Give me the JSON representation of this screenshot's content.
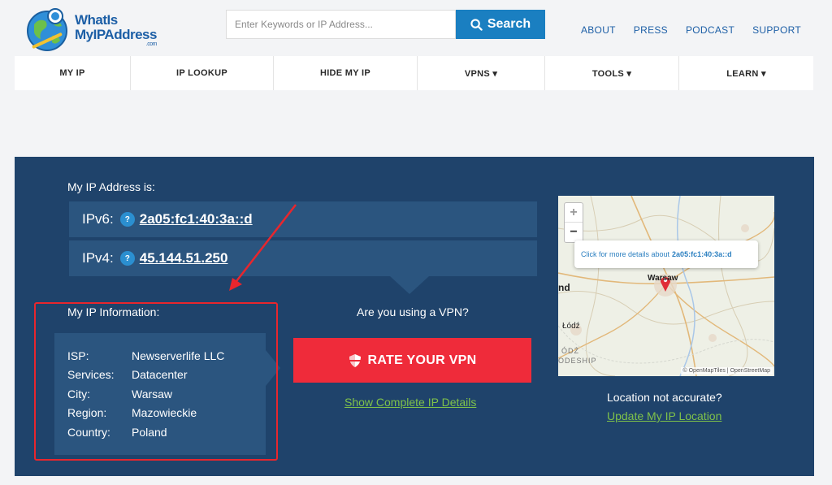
{
  "logo": {
    "line1": "WhatIs",
    "line2": "MyIPAddress",
    "com": ".com"
  },
  "search": {
    "placeholder": "Enter Keywords or IP Address...",
    "button": "Search"
  },
  "toplinks": [
    "ABOUT",
    "PRESS",
    "PODCAST",
    "SUPPORT"
  ],
  "nav": [
    {
      "label": "MY IP"
    },
    {
      "label": "IP LOOKUP"
    },
    {
      "label": "HIDE MY IP"
    },
    {
      "label": "VPNS ▾"
    },
    {
      "label": "TOOLS ▾"
    },
    {
      "label": "LEARN ▾"
    }
  ],
  "ip": {
    "heading": "My IP Address is:",
    "ipv6_label": "IPv6:",
    "ipv6_value": "2a05:fc1:40:3a::d",
    "ipv4_label": "IPv4:",
    "ipv4_value": "45.144.51.250",
    "help": "?"
  },
  "info": {
    "heading": "My IP Information:",
    "rows": [
      {
        "k": "ISP:",
        "v": "Newserverlife LLC"
      },
      {
        "k": "Services:",
        "v": "Datacenter"
      },
      {
        "k": "City:",
        "v": "Warsaw"
      },
      {
        "k": "Region:",
        "v": "Mazowieckie"
      },
      {
        "k": "Country:",
        "v": "Poland"
      }
    ]
  },
  "vpn": {
    "question": "Are you using a VPN?",
    "rate_button": "RATE YOUR VPN",
    "details_link": "Show Complete IP Details"
  },
  "map": {
    "zoom_in": "+",
    "zoom_out": "−",
    "popup_text": "Click for more details about",
    "popup_ip": "2a05:fc1:40:3a::d",
    "city_warsaw": "Warsaw",
    "city_lodz": "Łódź",
    "edge_text_1": "nd",
    "edge_text_2": "ÓDŹ",
    "edge_text_3": "ODESHIP",
    "attribution": "© OpenMapTiles | OpenStreetMap"
  },
  "location": {
    "question": "Location not accurate?",
    "update_link": "Update My IP Location"
  },
  "colors": {
    "panel": "#1f436b",
    "row": "#2b557f",
    "accent": "#1a7fc1",
    "red": "#ef2b3a",
    "green": "#7fc24a"
  }
}
